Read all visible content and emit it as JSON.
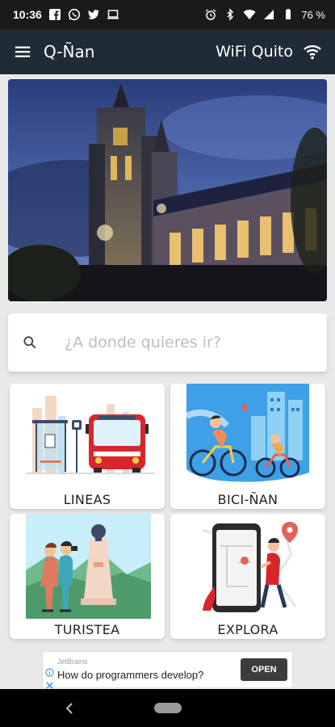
{
  "status_bar": {
    "time": "10:36",
    "battery": "76 %",
    "left_icons": [
      "facebook-icon",
      "whatsapp-icon",
      "twitter-icon",
      "laptop-icon"
    ],
    "right_icons": [
      "alarm-icon",
      "bluetooth-icon",
      "wifi-icon",
      "signal-icon",
      "battery-icon"
    ]
  },
  "app_bar": {
    "title": "Q-Ñan",
    "wifi_label": "WiFi Quito",
    "background": "#1f2b35"
  },
  "search": {
    "placeholder": "¿A donde quieres ir?"
  },
  "cards": {
    "lineas": "LINEAS",
    "bici": "BICI-ÑAN",
    "turistea": "TURISTEA",
    "explora": "EXPLORA"
  },
  "ad": {
    "brand": "JetBrains",
    "headline": "How do programmers develop?",
    "cta": "OPEN"
  },
  "colors": {
    "status_bar": "#1a1a1a",
    "app_bar": "#1f2b35",
    "background": "#e9e9e9",
    "bus_red": "#d9262c",
    "card_label": "#222222"
  }
}
